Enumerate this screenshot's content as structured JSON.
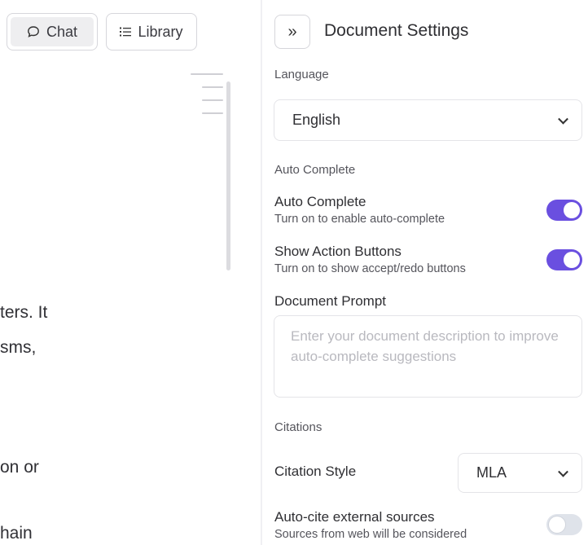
{
  "toolbar": {
    "chat_label": "Chat",
    "chat_icon": "chat-bubble-icon",
    "library_label": "Library",
    "library_icon": "list-icon"
  },
  "editor": {
    "fragments": [
      "ters. It",
      "sms,",
      "on or",
      "hain"
    ]
  },
  "settings": {
    "collapse_icon": "»",
    "title": "Document Settings",
    "language": {
      "section_label": "Language",
      "selected": "English"
    },
    "auto_complete_section": {
      "section_label": "Auto Complete",
      "auto_complete": {
        "title": "Auto Complete",
        "subtitle": "Turn on to enable auto-complete",
        "enabled": true
      },
      "show_action_buttons": {
        "title": "Show Action Buttons",
        "subtitle": "Turn on to show accept/redo buttons",
        "enabled": true
      },
      "document_prompt": {
        "title": "Document Prompt",
        "placeholder": "Enter your document description to improve auto-complete suggestions",
        "value": ""
      }
    },
    "citations": {
      "section_label": "Citations",
      "citation_style": {
        "label": "Citation Style",
        "selected": "MLA"
      },
      "auto_cite": {
        "title": "Auto-cite external sources",
        "subtitle": "Sources from web will be considered",
        "enabled": false
      }
    }
  },
  "colors": {
    "accent": "#6a4fe0",
    "toggle_off": "#dfe3ea"
  }
}
